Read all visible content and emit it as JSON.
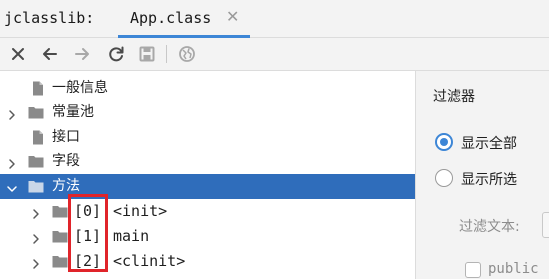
{
  "header": {
    "tool_title": "jclasslib:",
    "tab": {
      "label": "App.class",
      "close": "✕"
    }
  },
  "toolbar": {
    "buttons": [
      "close-icon",
      "back-arrow-icon",
      "forward-arrow-icon",
      "refresh-icon",
      "save-icon",
      "web-icon"
    ]
  },
  "tree": {
    "items": [
      {
        "label": "一般信息",
        "icon": "file-icon",
        "expandable": false
      },
      {
        "label": "常量池",
        "icon": "folder-icon",
        "expandable": true,
        "expanded": false
      },
      {
        "label": "接口",
        "icon": "file-icon",
        "expandable": false
      },
      {
        "label": "字段",
        "icon": "folder-icon",
        "expandable": true,
        "expanded": false
      },
      {
        "label": "方法",
        "icon": "folder-icon",
        "expandable": true,
        "expanded": true,
        "selected": true
      },
      {
        "index": "[0]",
        "name": "<init>",
        "icon": "folder-icon",
        "expandable": true,
        "expanded": false
      },
      {
        "index": "[1]",
        "name": "main",
        "icon": "folder-icon",
        "expandable": true,
        "expanded": false
      },
      {
        "index": "[2]",
        "name": "<clinit>",
        "icon": "folder-icon",
        "expandable": true,
        "expanded": false
      }
    ]
  },
  "filter_panel": {
    "title": "过滤器",
    "options": [
      {
        "label": "显示全部",
        "checked": true
      },
      {
        "label": "显示所选",
        "checked": false
      }
    ],
    "filter_text_label": "过滤文本:",
    "filter_text_value": "",
    "public_label": "public",
    "public_checked": false
  },
  "colors": {
    "selection": "#2f6dbb",
    "accent": "#3d86d6",
    "highlight_border": "#e0242a",
    "panel_bg": "#f3f3f3"
  }
}
